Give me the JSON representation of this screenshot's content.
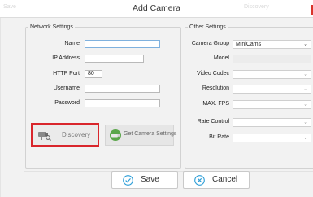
{
  "dialog": {
    "title": "Add Camera",
    "ghost_left": "Save",
    "ghost_right": "Discovery"
  },
  "network": {
    "legend": "Network Settings",
    "name_label": "Name",
    "name_value": "",
    "ip_label": "IP Address",
    "ip_value": "",
    "port_label": "HTTP Port",
    "port_value": "80",
    "user_label": "Username",
    "user_value": "",
    "pass_label": "Password",
    "pass_value": "",
    "discovery_label": "Discovery",
    "get_settings_label": "Get Camera Settings"
  },
  "other": {
    "legend": "Other Settings",
    "group_label": "Camera Group",
    "group_value": "MiniCams",
    "model_label": "Model",
    "codec_label": "Video Codec",
    "resolution_label": "Resolution",
    "fps_label": "MAX. FPS",
    "rate_label": "Rate Control",
    "bitrate_label": "Bit Rate"
  },
  "footer": {
    "save_label": "Save",
    "cancel_label": "Cancel"
  },
  "colors": {
    "highlight": "#d9262c",
    "accent": "#7fb1de",
    "save_icon": "#2f9fd8",
    "cancel_icon": "#2f9fd8"
  },
  "icons": {
    "discovery": "camera-search-icon",
    "get_settings": "camera-settings-icon",
    "save": "check-circle-icon",
    "cancel": "x-circle-icon"
  }
}
